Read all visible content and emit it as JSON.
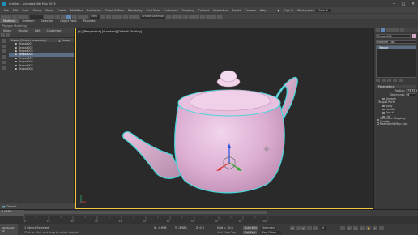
{
  "window": {
    "title": "Untitled - Autodesk 3ds Max 2019",
    "minimize": "–",
    "maximize": "□",
    "close": "×"
  },
  "menu": [
    "File",
    "Edit",
    "Tools",
    "Group",
    "Views",
    "Create",
    "Modifiers",
    "Animation",
    "Graph Editors",
    "Rendering",
    "Civil View",
    "Customize",
    "Scripting",
    "Content",
    "Interactive",
    "Arnold",
    "Camera",
    "Help"
  ],
  "user": {
    "signin": "Sign In",
    "workspace_label": "Workspaces:",
    "workspace": "Default"
  },
  "toolbar": {
    "selection_set": "Create Selection Se",
    "view_dropdown": "View"
  },
  "ribbon": {
    "tabs": [
      "Modeling",
      "Freeform",
      "Selection",
      "Object Paint",
      "Populate"
    ],
    "subtab": "Polygon Modeling"
  },
  "scene_explorer": {
    "tabs": [
      "Select",
      "Display",
      "Edit",
      "Customize"
    ],
    "header": "Name (Sorted Ascending)",
    "frozen_col": "▲ Frozen",
    "items": [
      "Teapot001",
      "Teapot002",
      "Teapot003",
      "Teapot004",
      "Teapot005",
      "Teapot006",
      "Teapot007",
      "Teapot008"
    ],
    "selected_index": 3,
    "layer": "Default"
  },
  "viewport": {
    "label": "[+] [Perspective] [Standard] [Default Shading]"
  },
  "command_panel": {
    "object_name": "Teapot004",
    "object_color": "#d5a8c8",
    "modifier_list": "Modifier List",
    "stack_item": "Teapot",
    "parameters_title": "Parameters",
    "radius_label": "Radius:",
    "radius_value": "73.819",
    "segments_label": "Segments:",
    "segments_value": "4",
    "smooth_label": "Smooth",
    "teapot_parts_label": "Teapot Parts",
    "parts": [
      "Body",
      "Handle",
      "Spout",
      "Lid"
    ],
    "mapping": "Generate Mapping Coords.",
    "real_world": "Real-World Map Size"
  },
  "timeline": {
    "counter": "0 / 100",
    "ticks": [
      "0",
      "10",
      "20",
      "30",
      "40",
      "50",
      "60",
      "70",
      "80",
      "90",
      "100"
    ]
  },
  "status": {
    "script_label": "MAXScript Mi",
    "selected": "1 Object Selected",
    "prompt": "Click or click-and-drag to select objects",
    "x_label": "X:",
    "x_value": "-4.998",
    "y_label": "Y:",
    "y_value": "-3.983",
    "z_label": "Z:",
    "z_value": "0.0",
    "grid": "Grid = 10.0",
    "add_time_tag": "Add Time Tag",
    "auto_key": "Auto Key",
    "set_key": "Set Key",
    "selected_dd": "Selected",
    "key_filters": "Key Filters...",
    "frame": "0"
  },
  "colors": {
    "teapot": "#e2b6d8",
    "selection_outline": "#44d6d9",
    "viewport_border": "#f0c640",
    "accent": "#5d88b8"
  }
}
